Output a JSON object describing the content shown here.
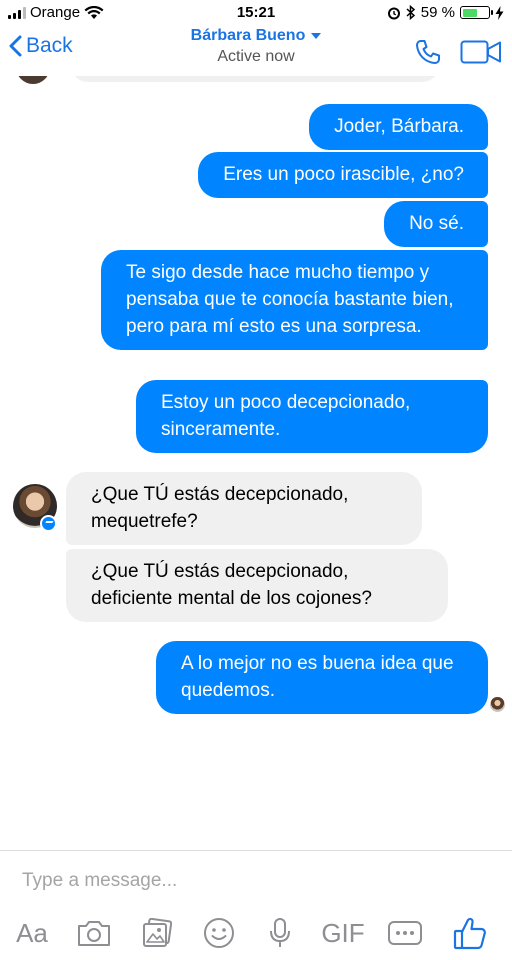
{
  "status_bar": {
    "carrier": "Orange",
    "time": "15:21",
    "battery_percent": "59 %",
    "battery_level": 0.59
  },
  "header": {
    "back_label": "Back",
    "contact_name": "Bárbara Bueno",
    "status": "Active now"
  },
  "messages": [
    {
      "direction": "outgoing",
      "text": "Joder, Bárbara."
    },
    {
      "direction": "outgoing",
      "text": "Eres un poco irascible, ¿no?"
    },
    {
      "direction": "outgoing",
      "text": "No sé."
    },
    {
      "direction": "outgoing",
      "text": "Te sigo desde hace mucho tiempo y pensaba que te conocía bastante bien, pero para mí esto es una sorpresa."
    },
    {
      "direction": "outgoing",
      "text": "Estoy un poco decepcionado, sinceramente."
    },
    {
      "direction": "incoming",
      "text": "¿Que TÚ estás decepcionado, mequetrefe?"
    },
    {
      "direction": "incoming",
      "text": "¿Que TÚ estás decepcionado, deficiente mental de los cojones?"
    },
    {
      "direction": "outgoing",
      "text": "A lo mejor no es buena idea que quedemos."
    }
  ],
  "composer": {
    "placeholder": "Type a message...",
    "tools": {
      "text_label": "Aa",
      "gif_label": "GIF"
    }
  },
  "colors": {
    "accent": "#1b74e4",
    "outgoing_bubble": "#0084ff",
    "incoming_bubble": "#f1f0f0"
  }
}
